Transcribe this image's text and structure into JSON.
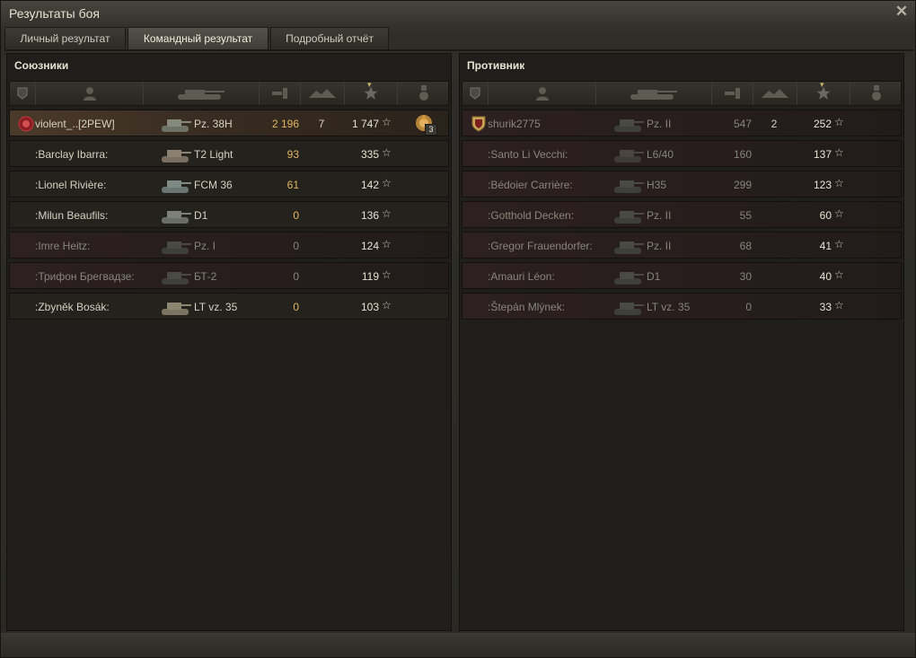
{
  "window": {
    "title": "Результаты боя",
    "close_label": "✕"
  },
  "tabs": [
    {
      "label": "Личный результат",
      "active": false
    },
    {
      "label": "Командный результат",
      "active": true
    },
    {
      "label": "Подробный отчёт",
      "active": false
    }
  ],
  "allies": {
    "title": "Союзники",
    "rows": [
      {
        "name": "violent_..[2PEW]",
        "vehicle": "Pz. 38H",
        "damage": "2 196",
        "frags": "7",
        "xp": "1 747",
        "state": "self",
        "clan_icon": "clan-emblem-icon",
        "medal": "3"
      },
      {
        "name": ":Barclay Ibarra:",
        "vehicle": "T2 Light",
        "damage": "93",
        "frags": "",
        "xp": "335",
        "state": "alive"
      },
      {
        "name": ":Lionel Rivière:",
        "vehicle": "FCM 36",
        "damage": "61",
        "frags": "",
        "xp": "142",
        "state": "alive"
      },
      {
        "name": ":Milun Beaufils:",
        "vehicle": "D1",
        "damage": "0",
        "frags": "",
        "xp": "136",
        "state": "alive"
      },
      {
        "name": ":Imre Heitz:",
        "vehicle": "Pz. I",
        "damage": "0",
        "frags": "",
        "xp": "124",
        "state": "dead"
      },
      {
        "name": ":Трифон Брегвадзе:",
        "vehicle": "БТ-2",
        "damage": "0",
        "frags": "",
        "xp": "119",
        "state": "dead"
      },
      {
        "name": ":Zbyněk Bosák:",
        "vehicle": "LT vz. 35",
        "damage": "0",
        "frags": "",
        "xp": "103",
        "state": "alive"
      }
    ]
  },
  "enemies": {
    "title": "Противник",
    "rows": [
      {
        "name": "shurik2775",
        "vehicle": "Pz. II",
        "damage": "547",
        "frags": "2",
        "xp": "252",
        "state": "dead",
        "clan_icon": "clan-shield-icon"
      },
      {
        "name": ":Santo Li Vecchi:",
        "vehicle": "L6/40",
        "damage": "160",
        "frags": "",
        "xp": "137",
        "state": "dead"
      },
      {
        "name": ":Bédoier Carrière:",
        "vehicle": "H35",
        "damage": "299",
        "frags": "",
        "xp": "123",
        "state": "dead"
      },
      {
        "name": ":Gotthold Decken:",
        "vehicle": "Pz. II",
        "damage": "55",
        "frags": "",
        "xp": "60",
        "state": "dead"
      },
      {
        "name": ":Gregor Frauendorfer:",
        "vehicle": "Pz. II",
        "damage": "68",
        "frags": "",
        "xp": "41",
        "state": "dead"
      },
      {
        "name": ":Amauri Léon:",
        "vehicle": "D1",
        "damage": "30",
        "frags": "",
        "xp": "40",
        "state": "dead"
      },
      {
        "name": ":Štepán Mlýnek:",
        "vehicle": "LT vz. 35",
        "damage": "0",
        "frags": "",
        "xp": "33",
        "state": "dead"
      }
    ]
  },
  "columns": [
    "squad-icon",
    "player-icon",
    "tank-icon",
    "damage-icon",
    "frags-icon",
    "xp-star-icon",
    "medal-icon"
  ],
  "star_glyph": "☆",
  "colors": {
    "damage": "#e3b560",
    "self_row": "#4a3a2a",
    "dead_row": "#2c2020"
  }
}
